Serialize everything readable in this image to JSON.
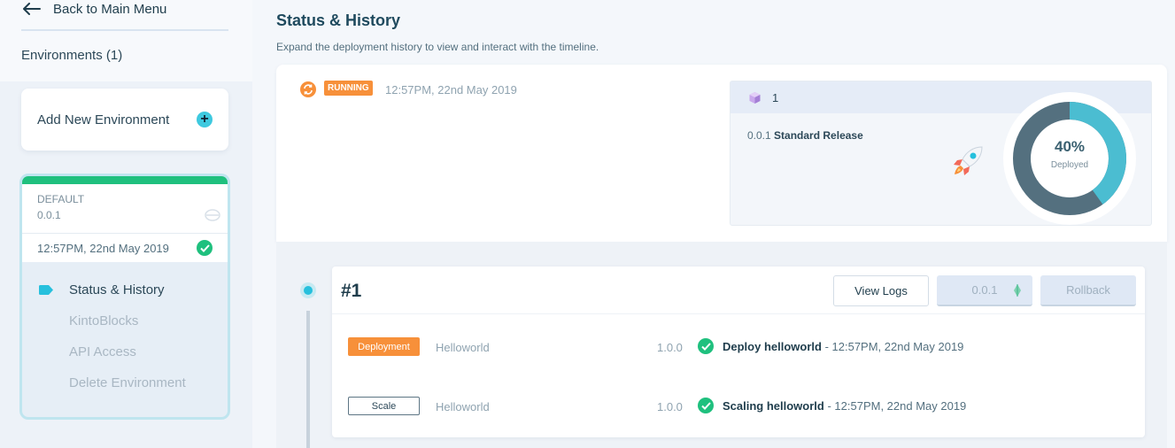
{
  "sidebar": {
    "back_label": "Back to Main Menu",
    "environments_label": "Environments (1)",
    "add_environment_label": "Add New Environment",
    "environment": {
      "name": "DEFAULT",
      "version": "0.0.1",
      "timestamp": "12:57PM, 22nd May 2019",
      "accent_color": "#1fc07e"
    },
    "nav": [
      {
        "label": "Status & History",
        "active": true
      },
      {
        "label": "KintoBlocks",
        "active": false
      },
      {
        "label": "API Access",
        "active": false
      },
      {
        "label": "Delete Environment",
        "active": false
      }
    ]
  },
  "main": {
    "title": "Status & History",
    "subtitle": "Expand the deployment history to view and interact with the timeline.",
    "status": {
      "badge": "RUNNING",
      "timestamp": "12:57PM, 22nd May 2019",
      "badge_color": "#f7903a",
      "icon": "sync-icon"
    },
    "release": {
      "count": "1",
      "version": "0.0.1",
      "name": "Standard Release",
      "percent_label": "40%",
      "percent_value": 0.4,
      "deployed_label": "Deployed",
      "icon": "rocket-icon"
    },
    "deployment": {
      "number": "#1",
      "view_logs_label": "View Logs",
      "version_select": "0.0.1",
      "rollback_label": "Rollback",
      "rows": [
        {
          "type": "Deployment",
          "service": "Helloworld",
          "version": "1.0.0",
          "action": "Deploy helloworld",
          "time": " - 12:57PM, 22nd May 2019"
        },
        {
          "type": "Scale",
          "service": "Helloworld",
          "version": "1.0.0",
          "action": "Scaling helloworld",
          "time": " - 12:57PM, 22nd May 2019"
        }
      ]
    }
  }
}
